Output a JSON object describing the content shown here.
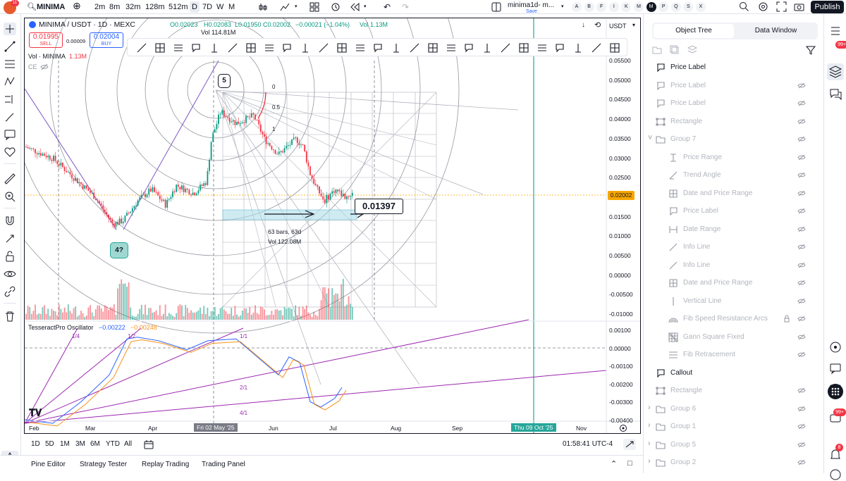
{
  "topbar": {
    "avatar_badge": "11",
    "symbol_search": "MINIMAI",
    "timeframes": [
      "2m",
      "8m",
      "32m",
      "128m",
      "512m",
      "D",
      "7D",
      "W",
      "M"
    ],
    "active_timeframe": "D",
    "layout_name": "minima1d- m...",
    "layout_status": "Save",
    "watchlist_letters": [
      "A",
      "B",
      "F",
      "I",
      "K",
      "M",
      "M",
      "P",
      "Q",
      "S",
      "X"
    ],
    "active_letter_index": 6,
    "publish_label": "Publish"
  },
  "legend": {
    "title": "MINIMA / USDT · 1D · MEXC",
    "ohlc_o": "O0.02023",
    "ohlc_h": "H0.02083",
    "ohlc_l": "L0.01950",
    "ohlc_c": "C0.02002",
    "change": "−0.00021 (−1.04%)",
    "vol": "Vol 1.13M",
    "vol_sub": "Vol 114.81M",
    "sell_price": "0.01995",
    "sell_label": "SELL",
    "spread": "0.00009",
    "buy_price": "0.02004",
    "buy_label": "BUY",
    "vol_indicator": "Vol · MINIMA",
    "vol_indicator_value": "1.13M",
    "ce_label": "CE",
    "currency": "USDT"
  },
  "chart": {
    "price_labels": [
      "0.05500",
      "0.05000",
      "0.04500",
      "0.04000",
      "0.03500",
      "0.03000",
      "0.02500",
      "0.02002",
      "0.01500",
      "0.01000",
      "0.00500",
      "0.00000",
      "-0.00500",
      "-0.01000"
    ],
    "current_price": "0.02002",
    "osc_labels": [
      "0.00100",
      "0.00000",
      "-0.00100",
      "-0.00200",
      "-0.00300",
      "-0.00400"
    ],
    "time_labels": [
      "Feb",
      "Mar",
      "Apr",
      "Fri 02 May '25",
      "Jun",
      "Jul",
      "Aug",
      "Sep",
      "Thu 09 Oct '25",
      "Nov"
    ],
    "callout_5": "5",
    "callout_4": "4?",
    "fib_levels": [
      "0",
      "0.5",
      "1"
    ],
    "price_label_box": "0.01397",
    "range_info_bars": "63 bars, 63d",
    "range_info_vol": "Vol 122.08M",
    "oscillator_name": "TesseractPro Oscillator",
    "oscillator_v1": "−0.00222",
    "oscillator_v2": "−0.00248",
    "gann_fan_labels": [
      "1/4",
      "1/2",
      "1/1",
      "2/1",
      "4/1"
    ]
  },
  "range_bar": {
    "ranges": [
      "1D",
      "5D",
      "1M",
      "3M",
      "6M",
      "YTD",
      "All"
    ],
    "clock": "01:58:41 UTC-4"
  },
  "bottombar": {
    "tabs": [
      "Pine Editor",
      "Strategy Tester",
      "Replay Trading",
      "Trading Panel"
    ]
  },
  "object_tree": {
    "tabs": [
      "Object Tree",
      "Data Window"
    ],
    "active_tab": "Object Tree",
    "items": [
      {
        "label": "Price Label",
        "icon": "price-label-icon",
        "indent": 0,
        "dim": false,
        "eye": false
      },
      {
        "label": "Price Label",
        "icon": "price-label-icon",
        "indent": 0,
        "dim": true,
        "eye": true
      },
      {
        "label": "Price Label",
        "icon": "price-label-icon",
        "indent": 0,
        "dim": true,
        "eye": true
      },
      {
        "label": "Rectangle",
        "icon": "rectangle-icon",
        "indent": 0,
        "dim": true,
        "eye": true
      },
      {
        "label": "Group 7",
        "icon": "folder-icon",
        "indent": 0,
        "dim": true,
        "eye": true,
        "expanded": true
      },
      {
        "label": "Price Range",
        "icon": "price-range-icon",
        "indent": 1,
        "dim": true,
        "eye": true
      },
      {
        "label": "Trend Angle",
        "icon": "trend-angle-icon",
        "indent": 1,
        "dim": true,
        "eye": true
      },
      {
        "label": "Date and Price Range",
        "icon": "date-price-range-icon",
        "indent": 1,
        "dim": true,
        "eye": true
      },
      {
        "label": "Price Label",
        "icon": "price-label-icon",
        "indent": 1,
        "dim": true,
        "eye": true
      },
      {
        "label": "Date Range",
        "icon": "date-range-icon",
        "indent": 1,
        "dim": true,
        "eye": true
      },
      {
        "label": "Info Line",
        "icon": "info-line-icon",
        "indent": 1,
        "dim": true,
        "eye": true
      },
      {
        "label": "Info Line",
        "icon": "info-line-icon",
        "indent": 1,
        "dim": true,
        "eye": true
      },
      {
        "label": "Date and Price Range",
        "icon": "date-price-range-icon",
        "indent": 1,
        "dim": true,
        "eye": true
      },
      {
        "label": "Vertical Line",
        "icon": "vertical-line-icon",
        "indent": 1,
        "dim": true,
        "eye": true
      },
      {
        "label": "Fib Speed Resistance Arcs",
        "icon": "fib-arcs-icon",
        "indent": 1,
        "dim": true,
        "eye": true,
        "locked": true
      },
      {
        "label": "Gann Square Fixed",
        "icon": "gann-square-icon",
        "indent": 1,
        "dim": true,
        "eye": true
      },
      {
        "label": "Fib Retracement",
        "icon": "fib-retracement-icon",
        "indent": 1,
        "dim": true,
        "eye": true
      },
      {
        "label": "Callout",
        "icon": "callout-icon",
        "indent": 0,
        "dim": false,
        "eye": false
      },
      {
        "label": "Rectangle",
        "icon": "rectangle-icon",
        "indent": 0,
        "dim": true,
        "eye": true
      },
      {
        "label": "Group 6",
        "icon": "folder-icon",
        "indent": 0,
        "dim": true,
        "eye": true,
        "collapsed": true
      },
      {
        "label": "Group 1",
        "icon": "folder-icon",
        "indent": 0,
        "dim": true,
        "eye": true,
        "collapsed": true
      },
      {
        "label": "Group 5",
        "icon": "folder-icon",
        "indent": 0,
        "dim": true,
        "eye": true,
        "collapsed": true
      },
      {
        "label": "Group 2",
        "icon": "folder-icon",
        "indent": 0,
        "dim": true,
        "eye": true,
        "collapsed": true
      }
    ]
  },
  "right_sidebar": {
    "badge_top": "99+",
    "badge_bottom": "99+",
    "badge_bell": "8"
  },
  "colors": {
    "accent": "#131722",
    "sell": "#f23645",
    "buy": "#2962ff",
    "up": "#089981",
    "down": "#f23645",
    "gann": "#9c27b0",
    "teal_line": "#26a69a",
    "current_price": "#f7a600"
  }
}
